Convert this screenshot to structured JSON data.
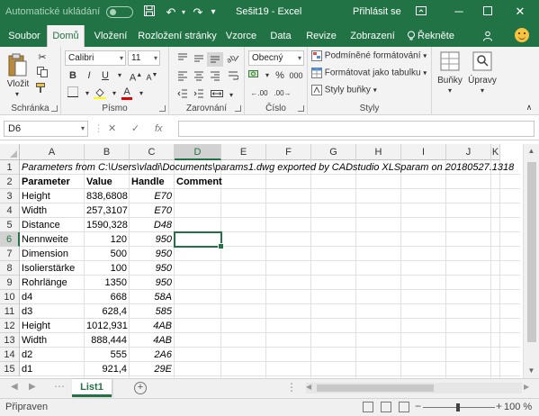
{
  "titlebar": {
    "autosave_label": "Automatické ukládání",
    "autosave_state": "off",
    "document_title": "Sešit19  -  Excel",
    "signin_label": "Přihlásit se",
    "save_icon": "floppy-icon",
    "undo_icon": "undo-icon",
    "redo_icon": "redo-icon"
  },
  "ribbon_tabs": [
    {
      "label": "Soubor"
    },
    {
      "label": "Domů",
      "active": true
    },
    {
      "label": "Vložení"
    },
    {
      "label": "Rozložení stránky"
    },
    {
      "label": "Vzorce"
    },
    {
      "label": "Data"
    },
    {
      "label": "Revize"
    },
    {
      "label": "Zobrazení"
    },
    {
      "label": "Řekněte"
    }
  ],
  "ribbon": {
    "clipboard": {
      "paste_label": "Vložit",
      "group_label": "Schránka"
    },
    "font": {
      "font_name": "Calibri",
      "font_size": "11",
      "bold": "B",
      "italic": "I",
      "underline": "U",
      "group_label": "Písmo"
    },
    "alignment": {
      "group_label": "Zarovnání"
    },
    "number": {
      "format": "Obecný",
      "percent": "%",
      "thousands": "000",
      "group_label": "Číslo"
    },
    "styles": {
      "conditional_formatting": "Podmíněné formátování",
      "format_as_table": "Formátovat jako tabulku",
      "cell_styles": "Styly buňky",
      "group_label": "Styly"
    },
    "cells": {
      "label": "Buňky"
    },
    "editing": {
      "label": "Úpravy"
    }
  },
  "formula_bar": {
    "name_box": "D6",
    "cancel": "✕",
    "confirm": "✓",
    "fx": "fx",
    "content": ""
  },
  "grid": {
    "columns": [
      "A",
      "B",
      "C",
      "D",
      "E",
      "F",
      "G",
      "H",
      "I",
      "J",
      "K"
    ],
    "selected_column": "D",
    "selected_row": 6,
    "rows": [
      {
        "n": "1",
        "a": "Parameters from C:\\Users\\vladi\\Documents\\params1.dwg exported by CADstudio XLSparam on 20180527.1318",
        "b": "",
        "c": "",
        "d": ""
      },
      {
        "n": "2",
        "a": "Parameter",
        "b": "Value",
        "c": "Handle",
        "d": "Comment"
      },
      {
        "n": "3",
        "a": "Height",
        "b": "838,6808",
        "c": "E70",
        "d": ""
      },
      {
        "n": "4",
        "a": "Width",
        "b": "257,3107",
        "c": "E70",
        "d": ""
      },
      {
        "n": "5",
        "a": "Distance",
        "b": "1590,328",
        "c": "D48",
        "d": ""
      },
      {
        "n": "6",
        "a": "Nennweite",
        "b": "120",
        "c": "950",
        "d": ""
      },
      {
        "n": "7",
        "a": "Dimension",
        "b": "500",
        "c": "950",
        "d": ""
      },
      {
        "n": "8",
        "a": "Isolierstärke",
        "b": "100",
        "c": "950",
        "d": ""
      },
      {
        "n": "9",
        "a": "Rohrlänge",
        "b": "1350",
        "c": "950",
        "d": ""
      },
      {
        "n": "10",
        "a": "d4",
        "b": "668",
        "c": "58A",
        "d": ""
      },
      {
        "n": "11",
        "a": "d3",
        "b": "628,4",
        "c": "585",
        "d": ""
      },
      {
        "n": "12",
        "a": "Height",
        "b": "1012,931",
        "c": "4AB",
        "d": ""
      },
      {
        "n": "13",
        "a": "Width",
        "b": "888,444",
        "c": "4AB",
        "d": ""
      },
      {
        "n": "14",
        "a": "d2",
        "b": "555",
        "c": "2A6",
        "d": ""
      },
      {
        "n": "15",
        "a": "d1",
        "b": "921,4",
        "c": "29E",
        "d": ""
      }
    ]
  },
  "sheets": [
    {
      "label": "List1",
      "active": true
    }
  ],
  "status": {
    "ready": "Připraven",
    "zoom": "100 %",
    "zoom_minus": "−",
    "zoom_plus": "+"
  },
  "colors": {
    "accent": "#217346",
    "ribbon_bg": "#f3f3f3"
  }
}
